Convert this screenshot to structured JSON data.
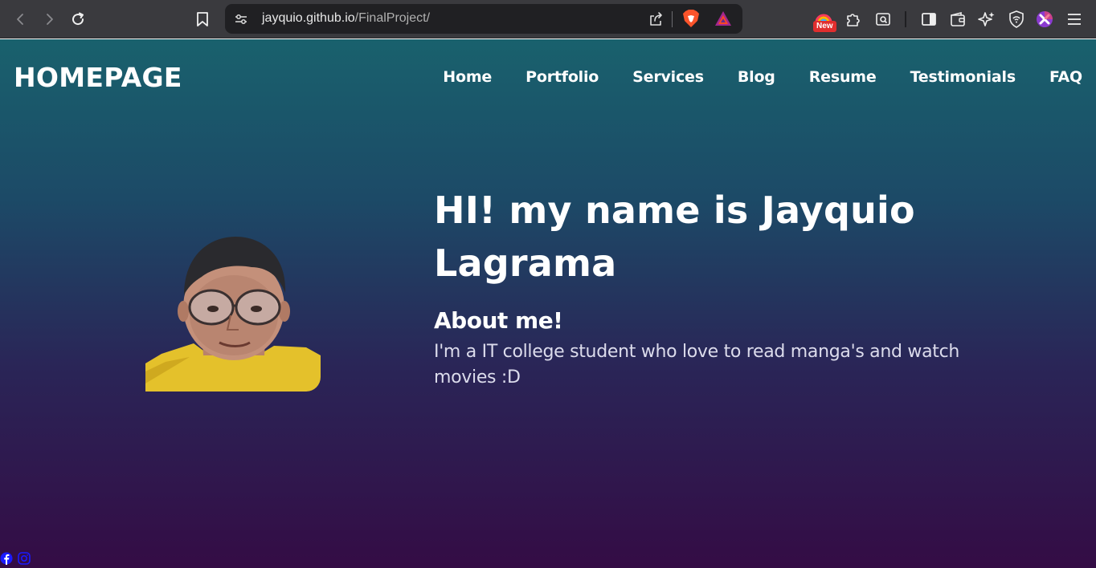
{
  "browser": {
    "url_host": "jayquio.github.io",
    "url_path": "/FinalProject/",
    "new_badge": "New",
    "icons": [
      "back-icon",
      "forward-icon",
      "reload-icon",
      "bookmark-icon",
      "site-info-icon",
      "share-icon",
      "brave-shields-icon",
      "brave-rewards-icon",
      "leo-icon",
      "extensions-icon",
      "reader-mode-icon",
      "sidebar-icon",
      "wallet-icon",
      "ai-icon",
      "vpn-icon",
      "profile-icon",
      "menu-icon"
    ]
  },
  "site": {
    "brand": "HOMEPAGE",
    "nav": [
      "Home",
      "Portfolio",
      "Services",
      "Blog",
      "Resume",
      "Testimonials",
      "FAQ"
    ]
  },
  "hero": {
    "title": "HI! my name is Jayquio Lagrama",
    "about_heading": "About me!",
    "about_text": "I'm a IT college student who love to read manga's and watch movies :D"
  },
  "footer": {
    "social_icons": [
      "facebook-icon",
      "instagram-icon"
    ]
  },
  "colors": {
    "gradient_top": "#19616d",
    "gradient_bottom": "#340c45",
    "chrome_bg": "#3a3a3e",
    "social_link": "#1a1aff"
  }
}
